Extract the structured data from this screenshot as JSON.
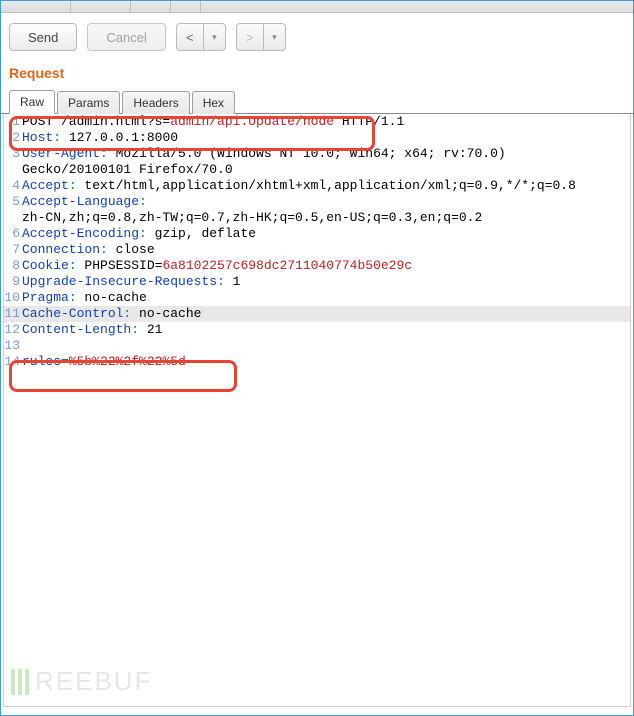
{
  "toolbar": {
    "send_label": "Send",
    "cancel_label": "Cancel"
  },
  "section_label": "Request",
  "tabs": {
    "raw": "Raw",
    "params": "Params",
    "headers": "Headers",
    "hex": "Hex"
  },
  "request_lines": [
    {
      "n": 1,
      "segments": [
        [
          "",
          "POST /admin.html?s="
        ],
        [
          "k-red",
          "admin/api.Update/node"
        ],
        [
          "",
          " HTTP/1.1"
        ]
      ]
    },
    {
      "n": 2,
      "segments": [
        [
          "k-blue",
          "Host"
        ],
        [
          "k-teal",
          ": "
        ],
        [
          "",
          "127.0.0.1:8000"
        ]
      ]
    },
    {
      "n": 3,
      "segments": [
        [
          "k-blue",
          "User-Agent"
        ],
        [
          "k-teal",
          ": "
        ],
        [
          "",
          "Mozilla/5.0 (Windows NT 10.0; Win64; x64; rv:70.0) "
        ]
      ]
    },
    {
      "n": "",
      "segments": [
        [
          "",
          "Gecko/20100101 Firefox/70.0"
        ]
      ]
    },
    {
      "n": 4,
      "segments": [
        [
          "k-blue",
          "Accept"
        ],
        [
          "k-teal",
          ": "
        ],
        [
          "",
          "text/html,application/xhtml+xml,application/xml;q=0.9,*/*;q=0.8"
        ]
      ]
    },
    {
      "n": 5,
      "segments": [
        [
          "k-blue",
          "Accept-Language"
        ],
        [
          "k-teal",
          ": "
        ]
      ]
    },
    {
      "n": "",
      "segments": [
        [
          "",
          "zh-CN,zh;q=0.8,zh-TW;q=0.7,zh-HK;q=0.5,en-US;q=0.3,en;q=0.2"
        ]
      ]
    },
    {
      "n": 6,
      "segments": [
        [
          "k-blue",
          "Accept-Encoding"
        ],
        [
          "k-teal",
          ": "
        ],
        [
          "",
          "gzip, deflate"
        ]
      ]
    },
    {
      "n": 7,
      "segments": [
        [
          "k-blue",
          "Connection"
        ],
        [
          "k-teal",
          ": "
        ],
        [
          "",
          "close"
        ]
      ]
    },
    {
      "n": 8,
      "segments": [
        [
          "k-blue",
          "Cookie"
        ],
        [
          "k-teal",
          ": "
        ],
        [
          "",
          "PHPSESSID="
        ],
        [
          "k-red",
          "6a8102257c698dc2711040774b50e29c"
        ]
      ]
    },
    {
      "n": 9,
      "segments": [
        [
          "k-blue",
          "Upgrade-Insecure-Requests"
        ],
        [
          "k-teal",
          ": "
        ],
        [
          "",
          "1"
        ]
      ]
    },
    {
      "n": 10,
      "segments": [
        [
          "k-blue",
          "Pragma"
        ],
        [
          "k-teal",
          ": "
        ],
        [
          "",
          "no-cache"
        ]
      ]
    },
    {
      "n": 11,
      "hl": true,
      "segments": [
        [
          "k-blue",
          "Cache-Control"
        ],
        [
          "k-teal",
          ": "
        ],
        [
          "",
          "no-cache"
        ]
      ]
    },
    {
      "n": 12,
      "segments": [
        [
          "k-blue",
          "Content-Length"
        ],
        [
          "k-teal",
          ": "
        ],
        [
          "",
          "21"
        ]
      ]
    },
    {
      "n": 13,
      "segments": [
        [
          "",
          ""
        ]
      ]
    },
    {
      "n": 14,
      "segments": [
        [
          "k-blue",
          "rules"
        ],
        [
          "k-teal",
          "="
        ],
        [
          "k-red",
          "%5b%22%2f%22%5d"
        ]
      ]
    }
  ],
  "watermark": "REEBUF"
}
